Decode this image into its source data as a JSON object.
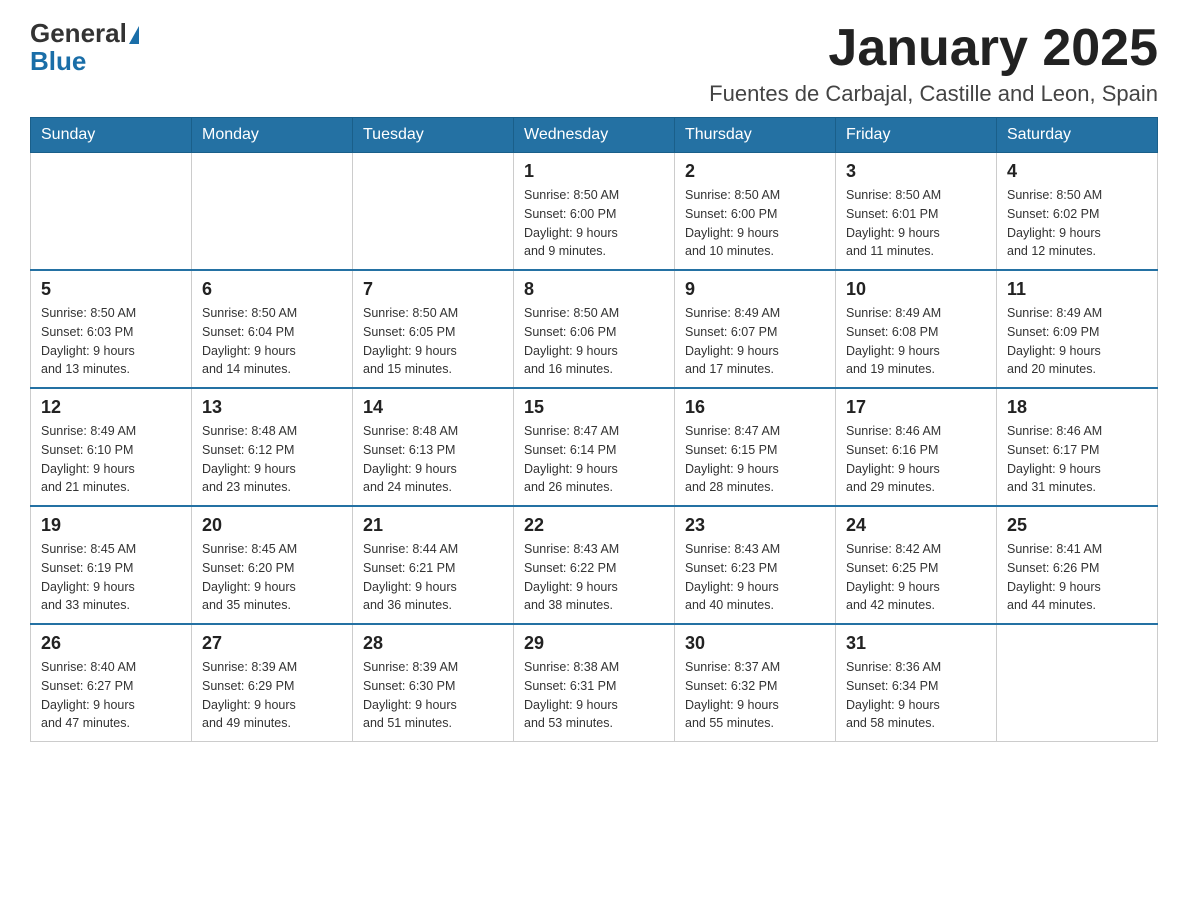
{
  "logo": {
    "general": "General",
    "blue": "Blue"
  },
  "header": {
    "month_title": "January 2025",
    "location": "Fuentes de Carbajal, Castille and Leon, Spain"
  },
  "days_of_week": [
    "Sunday",
    "Monday",
    "Tuesday",
    "Wednesday",
    "Thursday",
    "Friday",
    "Saturday"
  ],
  "weeks": [
    [
      {
        "day": "",
        "info": ""
      },
      {
        "day": "",
        "info": ""
      },
      {
        "day": "",
        "info": ""
      },
      {
        "day": "1",
        "info": "Sunrise: 8:50 AM\nSunset: 6:00 PM\nDaylight: 9 hours\nand 9 minutes."
      },
      {
        "day": "2",
        "info": "Sunrise: 8:50 AM\nSunset: 6:00 PM\nDaylight: 9 hours\nand 10 minutes."
      },
      {
        "day": "3",
        "info": "Sunrise: 8:50 AM\nSunset: 6:01 PM\nDaylight: 9 hours\nand 11 minutes."
      },
      {
        "day": "4",
        "info": "Sunrise: 8:50 AM\nSunset: 6:02 PM\nDaylight: 9 hours\nand 12 minutes."
      }
    ],
    [
      {
        "day": "5",
        "info": "Sunrise: 8:50 AM\nSunset: 6:03 PM\nDaylight: 9 hours\nand 13 minutes."
      },
      {
        "day": "6",
        "info": "Sunrise: 8:50 AM\nSunset: 6:04 PM\nDaylight: 9 hours\nand 14 minutes."
      },
      {
        "day": "7",
        "info": "Sunrise: 8:50 AM\nSunset: 6:05 PM\nDaylight: 9 hours\nand 15 minutes."
      },
      {
        "day": "8",
        "info": "Sunrise: 8:50 AM\nSunset: 6:06 PM\nDaylight: 9 hours\nand 16 minutes."
      },
      {
        "day": "9",
        "info": "Sunrise: 8:49 AM\nSunset: 6:07 PM\nDaylight: 9 hours\nand 17 minutes."
      },
      {
        "day": "10",
        "info": "Sunrise: 8:49 AM\nSunset: 6:08 PM\nDaylight: 9 hours\nand 19 minutes."
      },
      {
        "day": "11",
        "info": "Sunrise: 8:49 AM\nSunset: 6:09 PM\nDaylight: 9 hours\nand 20 minutes."
      }
    ],
    [
      {
        "day": "12",
        "info": "Sunrise: 8:49 AM\nSunset: 6:10 PM\nDaylight: 9 hours\nand 21 minutes."
      },
      {
        "day": "13",
        "info": "Sunrise: 8:48 AM\nSunset: 6:12 PM\nDaylight: 9 hours\nand 23 minutes."
      },
      {
        "day": "14",
        "info": "Sunrise: 8:48 AM\nSunset: 6:13 PM\nDaylight: 9 hours\nand 24 minutes."
      },
      {
        "day": "15",
        "info": "Sunrise: 8:47 AM\nSunset: 6:14 PM\nDaylight: 9 hours\nand 26 minutes."
      },
      {
        "day": "16",
        "info": "Sunrise: 8:47 AM\nSunset: 6:15 PM\nDaylight: 9 hours\nand 28 minutes."
      },
      {
        "day": "17",
        "info": "Sunrise: 8:46 AM\nSunset: 6:16 PM\nDaylight: 9 hours\nand 29 minutes."
      },
      {
        "day": "18",
        "info": "Sunrise: 8:46 AM\nSunset: 6:17 PM\nDaylight: 9 hours\nand 31 minutes."
      }
    ],
    [
      {
        "day": "19",
        "info": "Sunrise: 8:45 AM\nSunset: 6:19 PM\nDaylight: 9 hours\nand 33 minutes."
      },
      {
        "day": "20",
        "info": "Sunrise: 8:45 AM\nSunset: 6:20 PM\nDaylight: 9 hours\nand 35 minutes."
      },
      {
        "day": "21",
        "info": "Sunrise: 8:44 AM\nSunset: 6:21 PM\nDaylight: 9 hours\nand 36 minutes."
      },
      {
        "day": "22",
        "info": "Sunrise: 8:43 AM\nSunset: 6:22 PM\nDaylight: 9 hours\nand 38 minutes."
      },
      {
        "day": "23",
        "info": "Sunrise: 8:43 AM\nSunset: 6:23 PM\nDaylight: 9 hours\nand 40 minutes."
      },
      {
        "day": "24",
        "info": "Sunrise: 8:42 AM\nSunset: 6:25 PM\nDaylight: 9 hours\nand 42 minutes."
      },
      {
        "day": "25",
        "info": "Sunrise: 8:41 AM\nSunset: 6:26 PM\nDaylight: 9 hours\nand 44 minutes."
      }
    ],
    [
      {
        "day": "26",
        "info": "Sunrise: 8:40 AM\nSunset: 6:27 PM\nDaylight: 9 hours\nand 47 minutes."
      },
      {
        "day": "27",
        "info": "Sunrise: 8:39 AM\nSunset: 6:29 PM\nDaylight: 9 hours\nand 49 minutes."
      },
      {
        "day": "28",
        "info": "Sunrise: 8:39 AM\nSunset: 6:30 PM\nDaylight: 9 hours\nand 51 minutes."
      },
      {
        "day": "29",
        "info": "Sunrise: 8:38 AM\nSunset: 6:31 PM\nDaylight: 9 hours\nand 53 minutes."
      },
      {
        "day": "30",
        "info": "Sunrise: 8:37 AM\nSunset: 6:32 PM\nDaylight: 9 hours\nand 55 minutes."
      },
      {
        "day": "31",
        "info": "Sunrise: 8:36 AM\nSunset: 6:34 PM\nDaylight: 9 hours\nand 58 minutes."
      },
      {
        "day": "",
        "info": ""
      }
    ]
  ]
}
